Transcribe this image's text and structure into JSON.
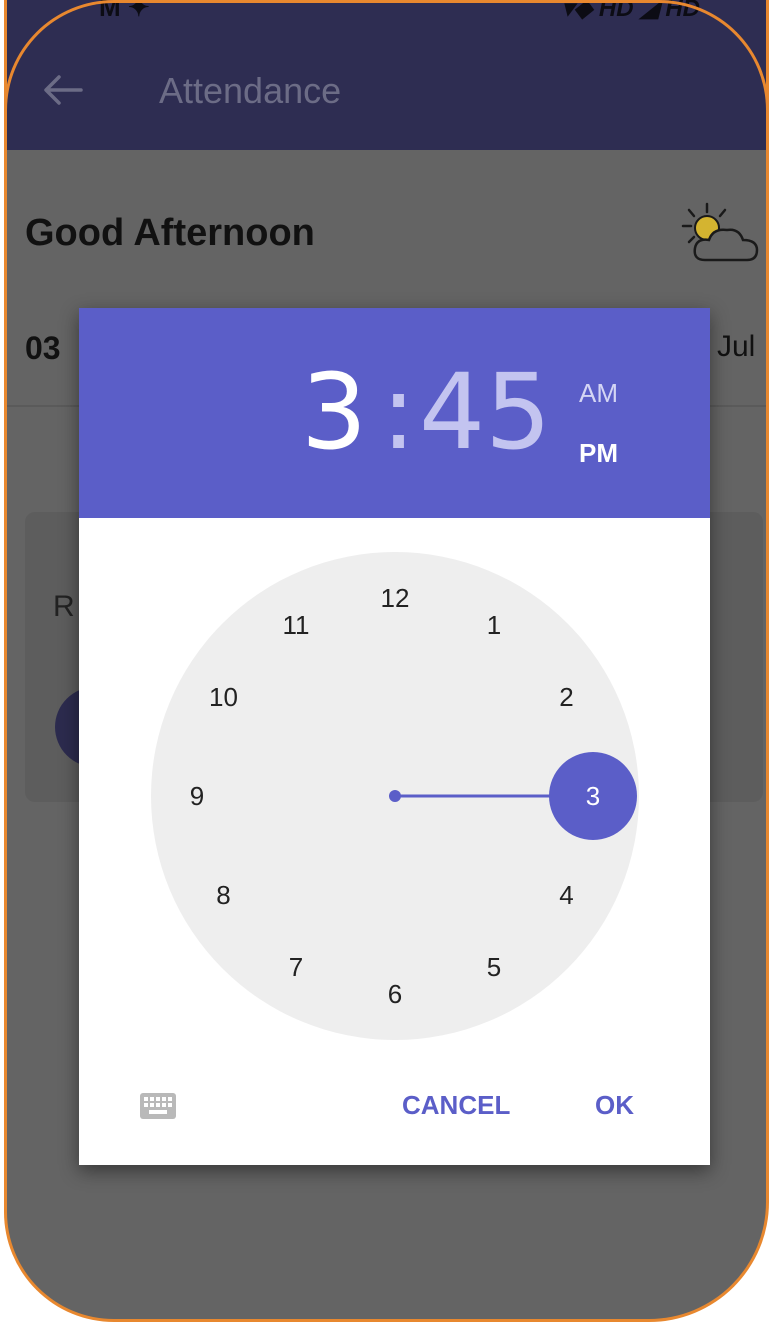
{
  "status_bar": {
    "left": "M ✦",
    "right": "▾◆ HD ◢ HD"
  },
  "appbar": {
    "title": "Attendance"
  },
  "greeting": "Good Afternoon",
  "date": {
    "left": "03",
    "right": "Jul"
  },
  "card": {
    "letter": "R"
  },
  "time_picker": {
    "hour": "3",
    "separator": ":",
    "minute": "45",
    "am_label": "AM",
    "pm_label": "PM",
    "selected_period": "PM",
    "selected_hour": "3",
    "clock_numbers": [
      "12",
      "1",
      "2",
      "3",
      "4",
      "5",
      "6",
      "7",
      "8",
      "9",
      "10",
      "11"
    ],
    "cancel_label": "CANCEL",
    "ok_label": "OK"
  },
  "colors": {
    "accent": "#5b5ec8",
    "appbar": "#2e2d52",
    "scrim_background": "#646464",
    "frame_border": "#e8882f"
  },
  "icons": [
    "back-arrow-icon",
    "weather-partly-sunny-icon",
    "keyboard-icon"
  ]
}
